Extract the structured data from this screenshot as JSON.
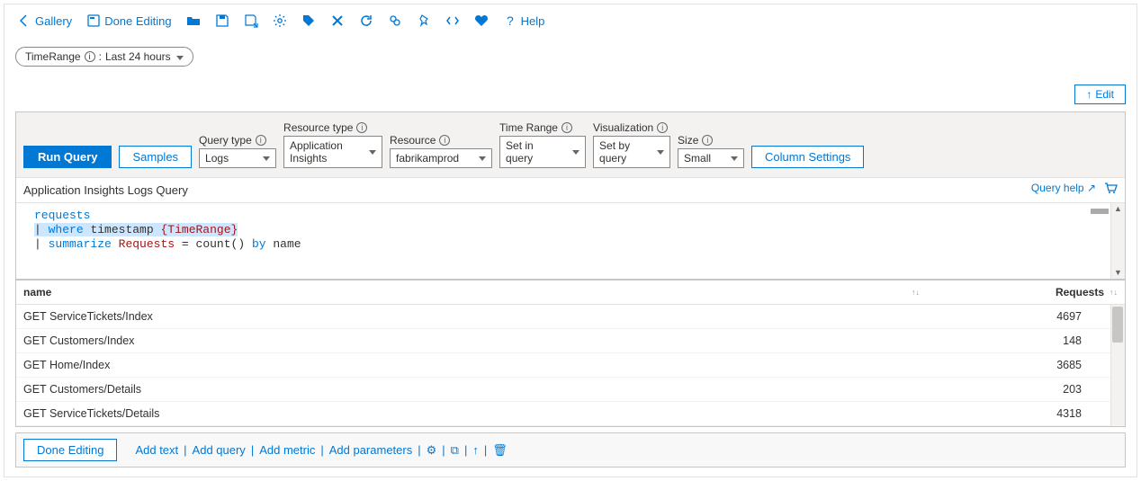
{
  "toolbar": {
    "gallery": "Gallery",
    "done_editing": "Done Editing",
    "help": "Help"
  },
  "params": {
    "time_range": {
      "name": "TimeRange",
      "value": "Last 24 hours"
    }
  },
  "panel": {
    "edit_label": "Edit",
    "run_query": "Run Query",
    "samples": "Samples",
    "column_settings": "Column Settings",
    "title": "Application Insights Logs Query",
    "query_help": "Query help",
    "controls": {
      "query_type": {
        "label": "Query type",
        "value": "Logs"
      },
      "resource_type": {
        "label": "Resource type",
        "value": "Application Insights"
      },
      "resource": {
        "label": "Resource",
        "value": "fabrikamprod"
      },
      "time_range": {
        "label": "Time Range",
        "value": "Set in query"
      },
      "visualization": {
        "label": "Visualization",
        "value": "Set by query"
      },
      "size": {
        "label": "Size",
        "value": "Small"
      }
    }
  },
  "editor": {
    "line1": "requests",
    "line2": {
      "op": "where",
      "col": "timestamp",
      "param": "{TimeRange}"
    },
    "line3": {
      "op": "summarize",
      "alias": "Requests",
      "eq": "=",
      "func": "count()",
      "by": "by",
      "group": "name"
    }
  },
  "results": {
    "columns": [
      "name",
      "Requests"
    ],
    "rows": [
      {
        "name": "GET ServiceTickets/Index",
        "requests": 4697
      },
      {
        "name": "GET Customers/Index",
        "requests": 148
      },
      {
        "name": "GET Home/Index",
        "requests": 3685
      },
      {
        "name": "GET Customers/Details",
        "requests": 203
      },
      {
        "name": "GET ServiceTickets/Details",
        "requests": 4318
      }
    ]
  },
  "footer": {
    "done_editing": "Done Editing",
    "add_text": "Add text",
    "add_query": "Add query",
    "add_metric": "Add metric",
    "add_parameters": "Add parameters"
  }
}
